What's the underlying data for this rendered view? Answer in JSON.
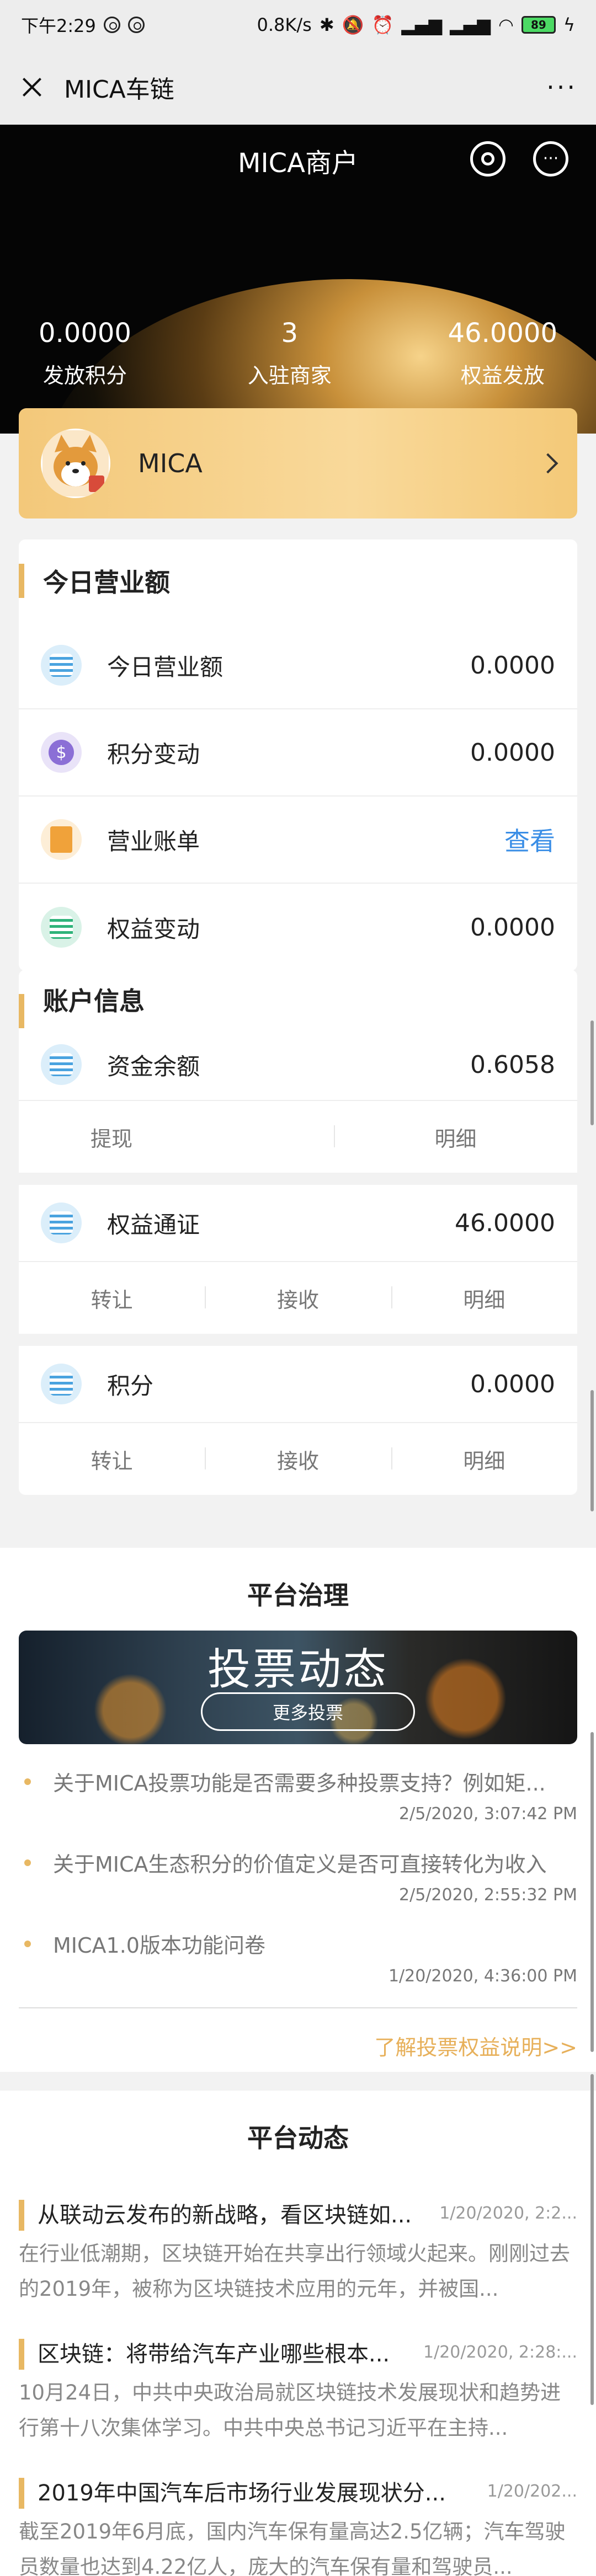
{
  "status_bar": {
    "time": "下午2:29",
    "network_speed": "0.8K/s",
    "battery": "89"
  },
  "nav": {
    "title": "MICA车链",
    "more": "···"
  },
  "hero": {
    "title": "MICA商户",
    "stats": [
      {
        "value": "0.0000",
        "label": "发放积分"
      },
      {
        "value": "3",
        "label": "入驻商家"
      },
      {
        "value": "46.0000",
        "label": "权益发放"
      }
    ]
  },
  "merchant": {
    "name": "MICA"
  },
  "today": {
    "title": "今日营业额",
    "rows": [
      {
        "label": "今日营业额",
        "value": "0.0000",
        "icon": "stack-icon",
        "color": "#4aa3df"
      },
      {
        "label": "积分变动",
        "value": "0.0000",
        "icon": "dollar-icon",
        "color": "#8b6fd6"
      },
      {
        "label": "营业账单",
        "link": "查看",
        "icon": "bill-icon",
        "color": "#f0a23a"
      },
      {
        "label": "权益变动",
        "value": "0.0000",
        "icon": "equity-icon",
        "color": "#2fb37a"
      }
    ]
  },
  "account": {
    "title": "账户信息",
    "balance": {
      "label": "资金余额",
      "value": "0.6058",
      "actions": [
        "提现",
        "明细"
      ]
    },
    "token": {
      "label": "权益通证",
      "value": "46.0000",
      "actions": [
        "转让",
        "接收",
        "明细"
      ]
    },
    "points": {
      "label": "积分",
      "value": "0.0000",
      "actions": [
        "转让",
        "接收",
        "明细"
      ]
    }
  },
  "governance": {
    "title": "平台治理",
    "banner_title": "投票动态",
    "banner_button": "更多投票",
    "items": [
      {
        "title": "关于MICA投票功能是否需要多种投票支持？例如矩...",
        "date": "2/5/2020, 3:07:42 PM"
      },
      {
        "title": "关于MICA生态积分的价值定义是否可直接转化为收入",
        "date": "2/5/2020, 2:55:32 PM"
      },
      {
        "title": "MICA1.0版本功能问卷",
        "date": "1/20/2020, 4:36:00 PM"
      }
    ],
    "learn_more": "了解投票权益说明>>"
  },
  "news": {
    "title": "平台动态",
    "items": [
      {
        "title": "从联动云发布的新战略，看区块链如...",
        "date": "1/20/2020, 2:2...",
        "body": "在行业低潮期，区块链开始在共享出行领域火起来。刚刚过去的2019年，被称为区块链技术应用的元年，并被国..."
      },
      {
        "title": "区块链：将带给汽车产业哪些根本...",
        "date": "1/20/2020, 2:28:...",
        "body": "10月24日，中共中央政治局就区块链技术发展现状和趋势进行第十八次集体学习。中共中央总书记习近平在主持..."
      },
      {
        "title": "2019年中国汽车后市场行业发展现状分...",
        "date": "1/20/202...",
        "body": "截至2019年6月底，国内汽车保有量高达2.5亿辆；汽车驾驶员数量也达到4.22亿人，庞大的汽车保有量和驾驶员..."
      }
    ]
  }
}
